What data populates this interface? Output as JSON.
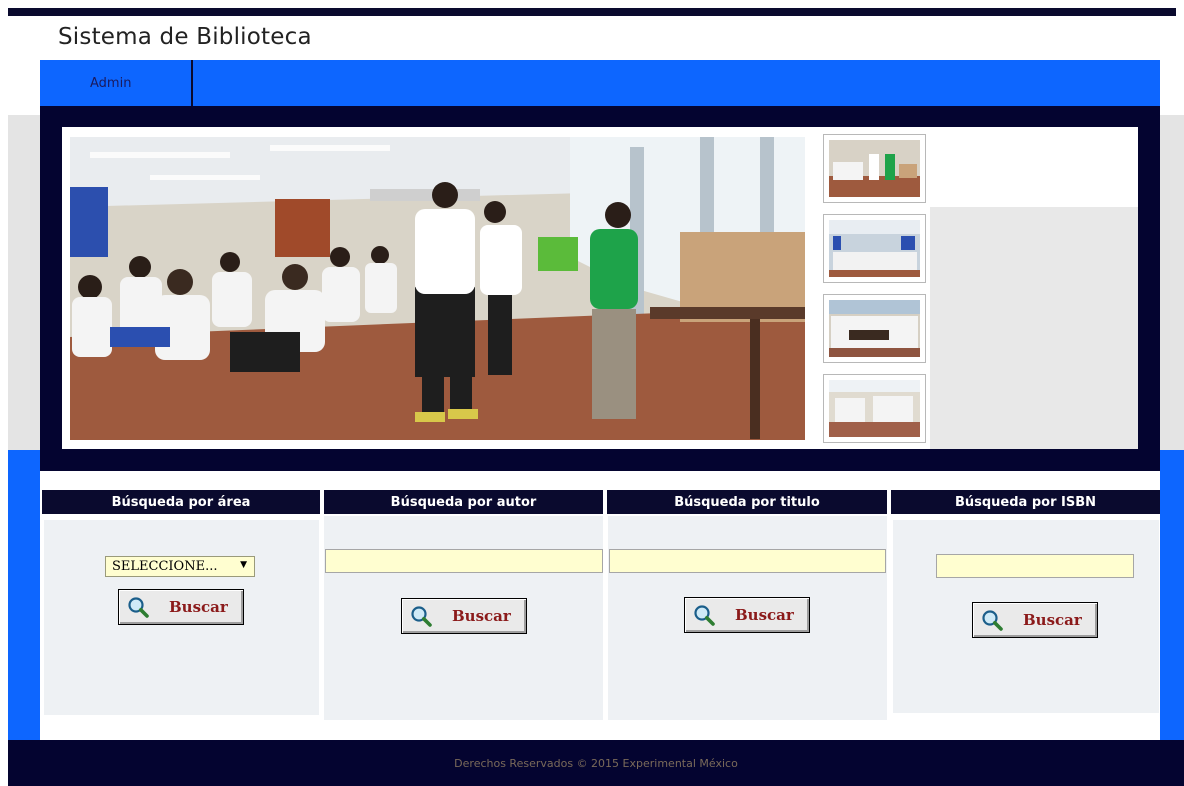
{
  "site": {
    "title": "Sistema de Biblioteca"
  },
  "nav": {
    "items": [
      {
        "label": "Admin"
      }
    ]
  },
  "slider": {
    "main_image": "classroom-photo",
    "thumbnails": [
      "classroom-thumb-1",
      "classroom-thumb-2",
      "classroom-thumb-3",
      "classroom-thumb-4"
    ]
  },
  "search": {
    "area": {
      "header": "Búsqueda por área",
      "select_value": "SELECCIONE...",
      "button_label": "Buscar"
    },
    "autor": {
      "header": "Búsqueda por autor",
      "input_value": "",
      "button_label": "Buscar"
    },
    "titulo": {
      "header": "Búsqueda por titulo",
      "input_value": "",
      "button_label": "Buscar"
    },
    "isbn": {
      "header": "Búsqueda por ISBN",
      "input_value": "",
      "button_label": "Buscar"
    }
  },
  "footer": {
    "text": "Derechos Reservados © 2015 Experimental México"
  },
  "colors": {
    "nav_blue": "#0d66ff",
    "dark_navy": "#040430",
    "input_yellow": "#fffed0",
    "button_text": "#8b1a1a"
  }
}
